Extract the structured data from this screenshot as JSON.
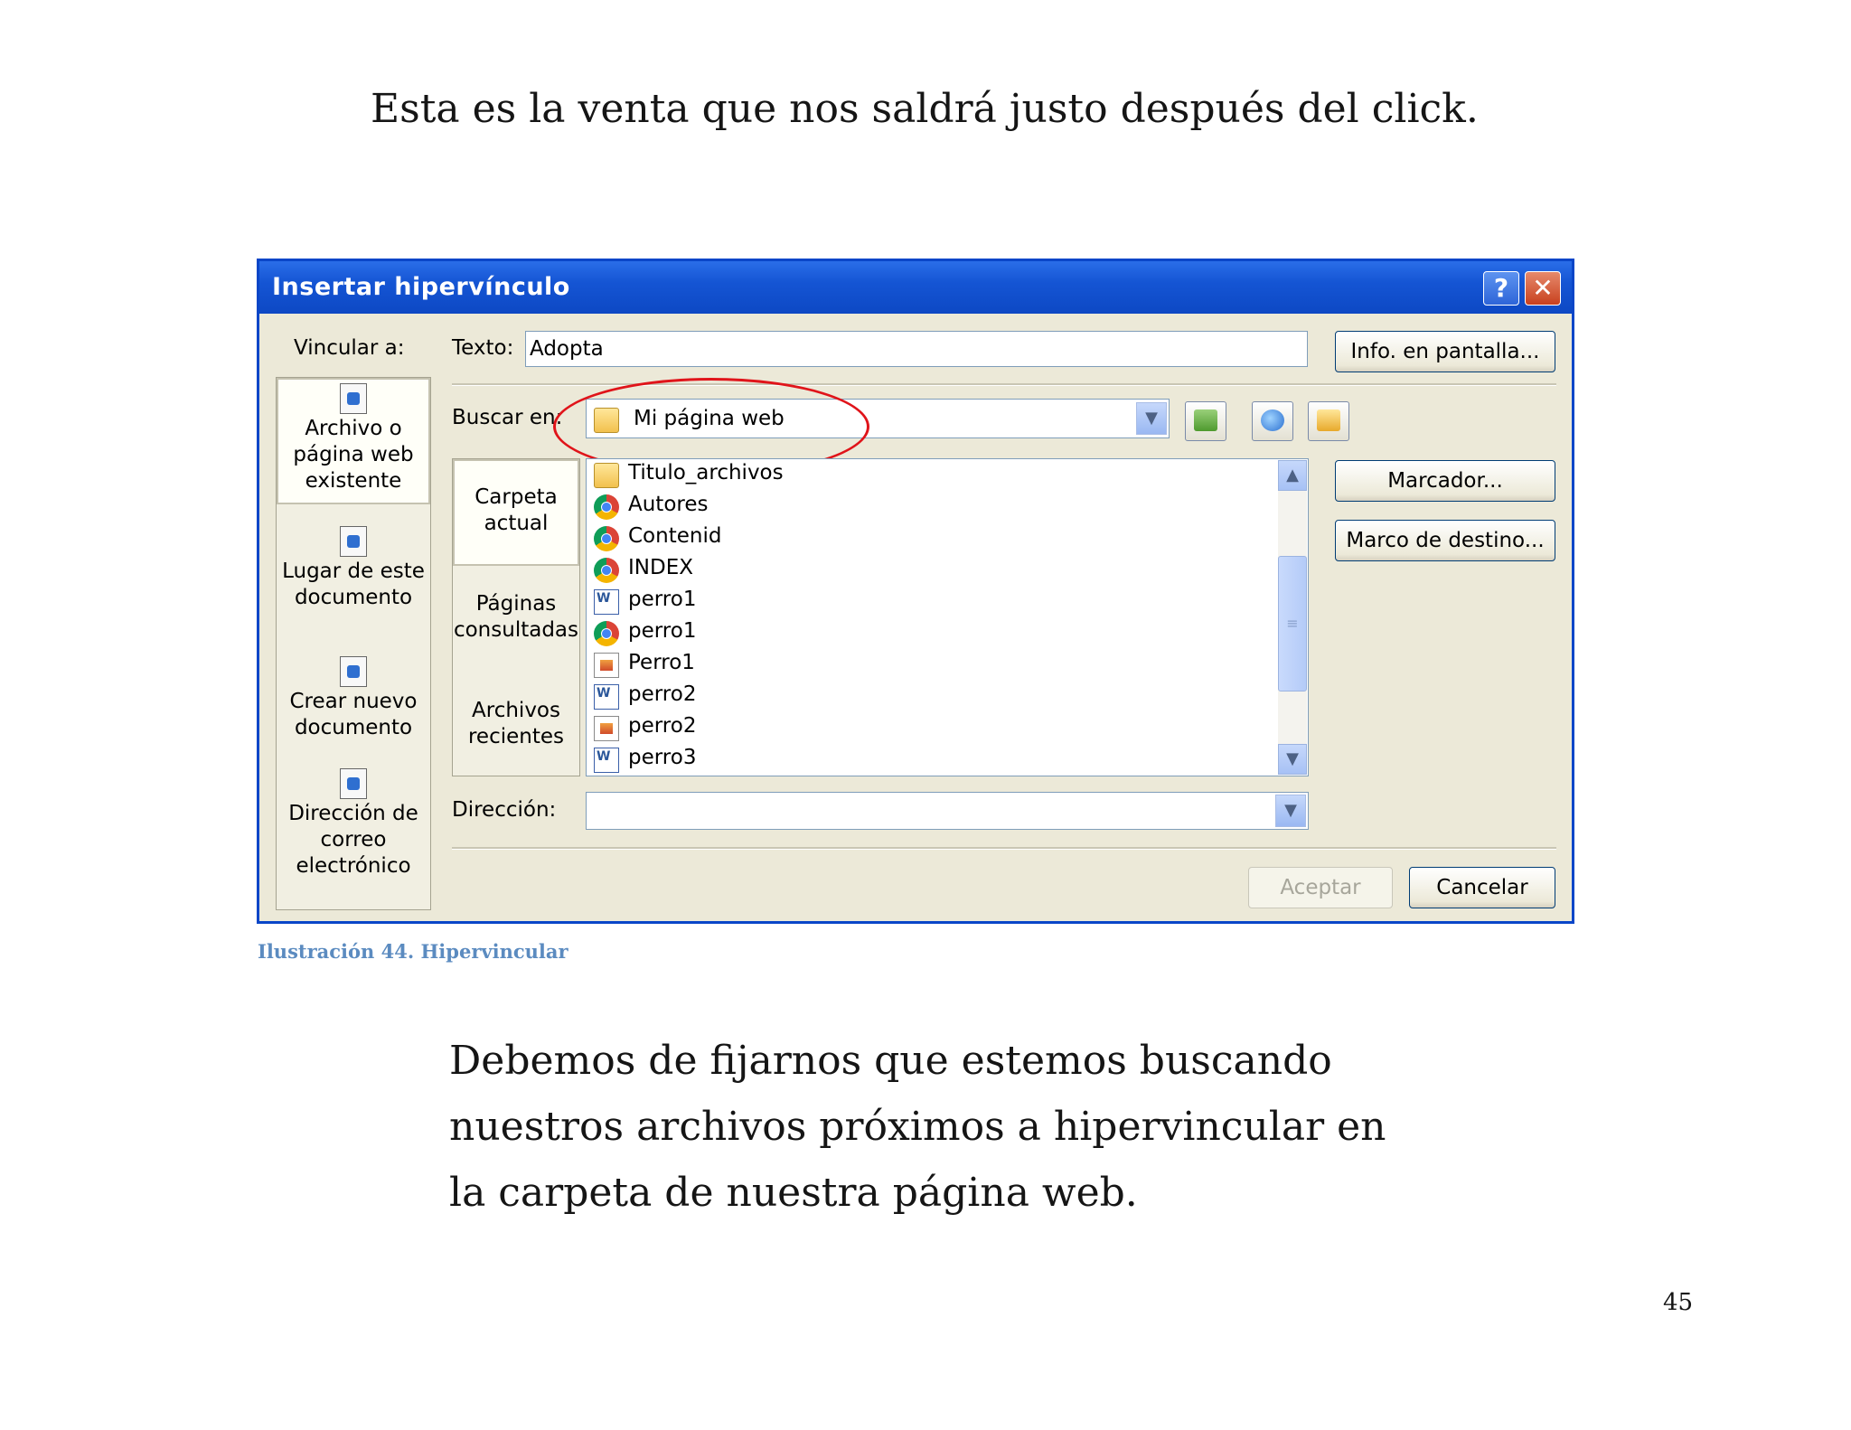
{
  "document": {
    "intro": "Esta es la venta que nos saldrá justo después del click.",
    "caption": "Ilustración 44. Hipervincular",
    "body_lines": [
      "Debemos de fijarnos que estemos buscando",
      "nuestros archivos próximos a hipervincular en",
      "la carpeta de nuestra página web."
    ],
    "page_number": "45"
  },
  "dialog": {
    "title": "Insertar hipervínculo",
    "help_glyph": "?",
    "close_glyph": "✕",
    "vincular_label": "Vincular a:",
    "link_options": [
      {
        "icon": "web-page-file-icon",
        "lines": [
          "Archivo o",
          "página web",
          "existente"
        ]
      },
      {
        "icon": "document-place-icon",
        "lines": [
          "Lugar de este",
          "documento"
        ]
      },
      {
        "icon": "new-document-icon",
        "lines": [
          "Crear nuevo",
          "documento"
        ]
      },
      {
        "icon": "email-address-icon",
        "lines": [
          "Dirección de",
          "correo",
          "electrónico"
        ]
      }
    ],
    "texto_label": "Texto:",
    "texto_value": "Adopta",
    "screen_tip_button": "Info. en pantalla...",
    "buscar_label": "Buscar en:",
    "buscar_value": "Mi página web",
    "nav_options": [
      {
        "lines": [
          "Carpeta",
          "actual"
        ]
      },
      {
        "lines": [
          "Páginas",
          "consultadas"
        ]
      },
      {
        "lines": [
          "Archivos",
          "recientes"
        ]
      }
    ],
    "files": [
      {
        "name": "Titulo_archivos",
        "icon": "folder"
      },
      {
        "name": "Autores",
        "icon": "chrome"
      },
      {
        "name": "Contenid",
        "icon": "chrome"
      },
      {
        "name": "INDEX",
        "icon": "chrome"
      },
      {
        "name": "perro1",
        "icon": "word"
      },
      {
        "name": "perro1",
        "icon": "chrome"
      },
      {
        "name": "Perro1",
        "icon": "image"
      },
      {
        "name": "perro2",
        "icon": "word"
      },
      {
        "name": "perro2",
        "icon": "image"
      },
      {
        "name": "perro3",
        "icon": "word"
      }
    ],
    "bookmark_button": "Marcador...",
    "target_frame_button": "Marco de destino...",
    "direccion_label": "Dirección:",
    "direccion_value": "",
    "accept_button": "Aceptar",
    "cancel_button": "Cancelar",
    "colors": {
      "titlebar": "#0d48c4",
      "highlight_circle": "#e0141a",
      "caption": "#5b8bc0"
    }
  }
}
